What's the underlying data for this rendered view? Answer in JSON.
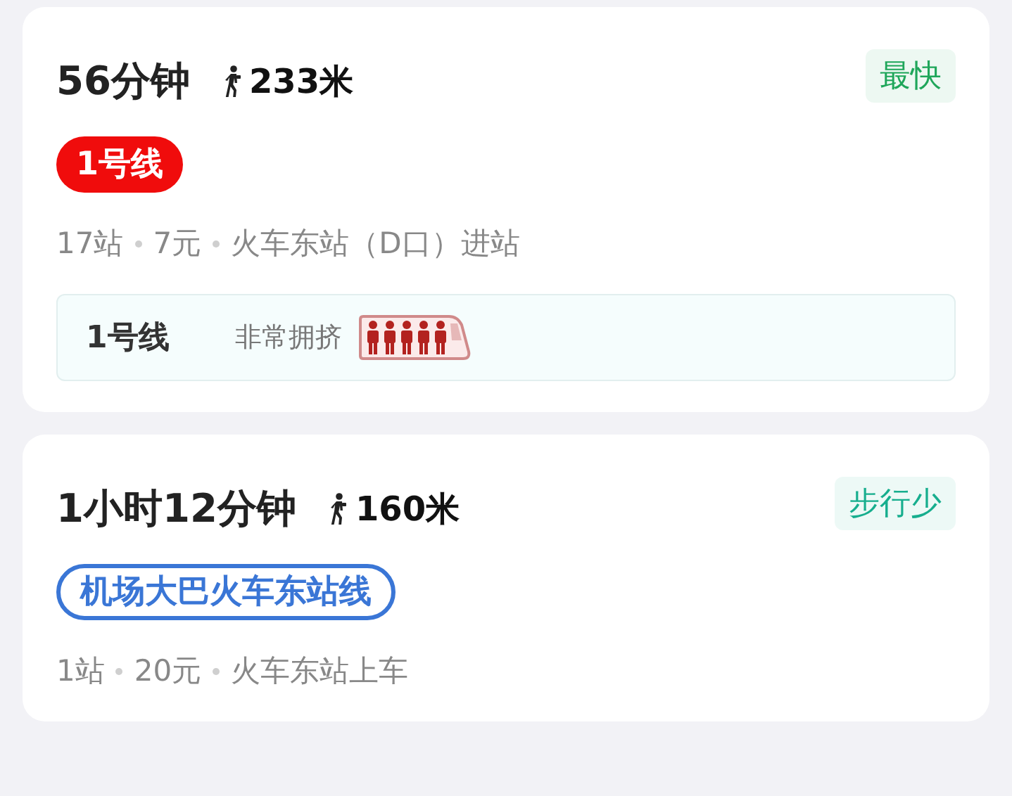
{
  "routes": [
    {
      "duration": "56分钟",
      "walk": "233米",
      "tag": {
        "text": "最快",
        "color": "#1fa65a"
      },
      "line": {
        "name": "1号线",
        "kind": "subway",
        "color": "#f00c0c"
      },
      "meta": [
        "17站",
        "7元",
        "火车东站（D口）进站"
      ],
      "crowding": {
        "line": "1号线",
        "text": "非常拥挤"
      }
    },
    {
      "duration": "1小时12分钟",
      "walk": "160米",
      "tag": {
        "text": "步行少",
        "color": "#17ae8e"
      },
      "line": {
        "name": "机场大巴火车东站线",
        "kind": "bus",
        "color": "#3a76d6"
      },
      "meta": [
        "1站",
        "20元",
        "火车东站上车"
      ]
    }
  ]
}
